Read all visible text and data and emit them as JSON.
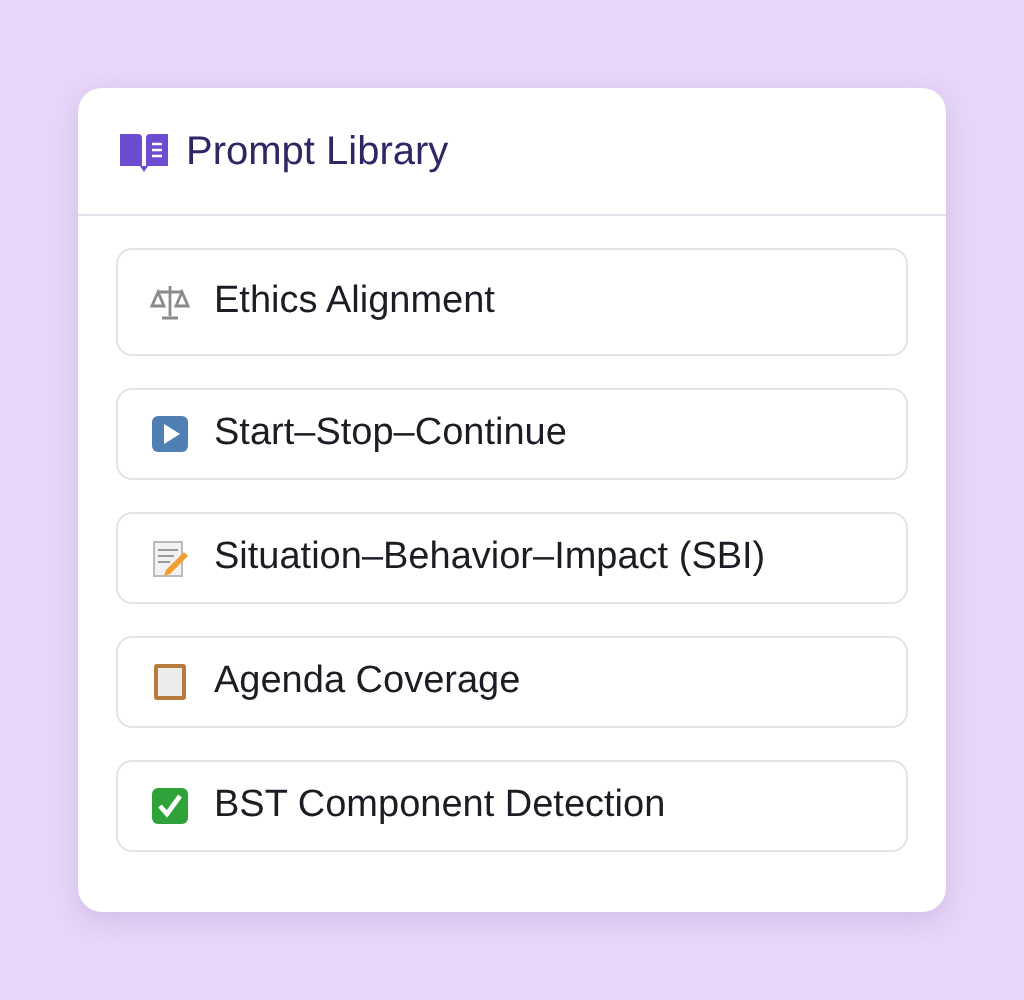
{
  "header": {
    "title": "Prompt Library"
  },
  "items": [
    {
      "label": "Ethics Alignment"
    },
    {
      "label": "Start–Stop–Continue"
    },
    {
      "label": "Situation–Behavior–Impact (SBI)"
    },
    {
      "label": "Agenda Coverage"
    },
    {
      "label": "BST Component Detection"
    }
  ]
}
